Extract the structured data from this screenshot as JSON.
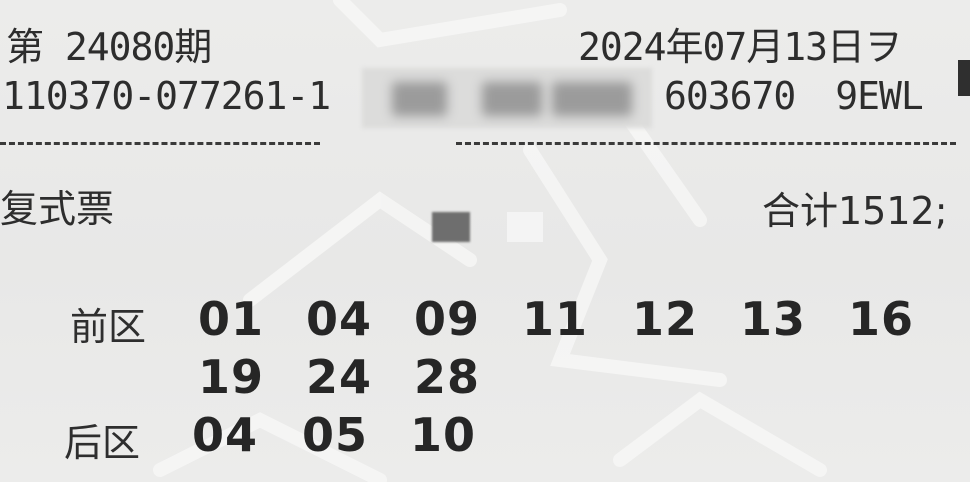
{
  "header": {
    "issue": "第 24080期",
    "date": "2024年07月13日ヲ",
    "serial_left": "110370-077261-1",
    "serial_code": "603670",
    "serial_suffix": "9EWL"
  },
  "ticket": {
    "type": "复式票",
    "total": "合计1512;"
  },
  "front_zone": {
    "label": "前区",
    "numbers": [
      "01",
      "04",
      "09",
      "11",
      "12",
      "13",
      "16",
      "19",
      "24",
      "28"
    ]
  },
  "back_zone": {
    "label": "后区",
    "numbers": [
      "04",
      "05",
      "10"
    ]
  },
  "colors": {
    "paper": "#e9e9e8",
    "ink": "#2a2a2a"
  }
}
